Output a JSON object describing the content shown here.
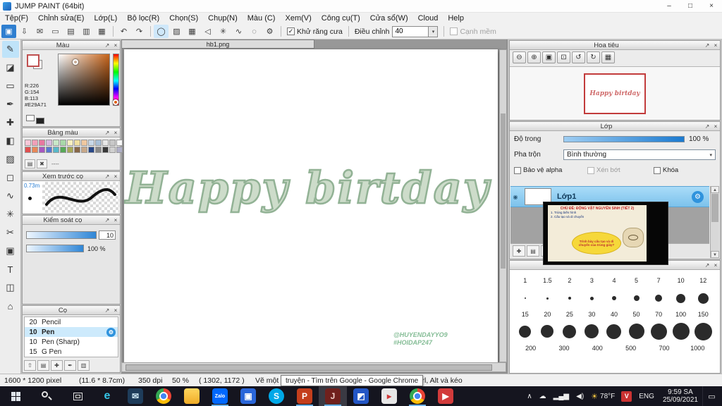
{
  "panel_chrome": {
    "undock_glyph": "↗",
    "close_glyph": "×",
    "check_glyph": "✓"
  },
  "window": {
    "title": "JUMP PAINT (64bit)",
    "buttons": {
      "min": "–",
      "max": "□",
      "close": "×"
    }
  },
  "menu": {
    "items": [
      "Tệp(F)",
      "Chỉnh sửa(E)",
      "Lớp(L)",
      "Bộ lọc(R)",
      "Chọn(S)",
      "Chụp(N)",
      "Màu (C)",
      "Xem(V)",
      "Công cụ(T)",
      "Cửa sổ(W)",
      "Cloud",
      "Help"
    ]
  },
  "toolbar": {
    "file_icons": [
      {
        "name": "paint-logo-icon",
        "glyph": "▣",
        "bg": "#2f7fd0",
        "fg": "#ffffff"
      },
      {
        "name": "export-icon",
        "glyph": "⇩"
      },
      {
        "name": "comment-icon",
        "glyph": "✉"
      },
      {
        "name": "display-icon",
        "glyph": "▭"
      },
      {
        "name": "new-canvas-icon",
        "glyph": "▤"
      },
      {
        "name": "open-canvas-icon",
        "glyph": "▥"
      },
      {
        "name": "grid-icon",
        "glyph": "▦"
      }
    ],
    "history_icons": [
      {
        "name": "undo-icon",
        "glyph": "↶"
      },
      {
        "name": "redo-icon",
        "glyph": "↷"
      }
    ],
    "mode_icons": [
      {
        "name": "ellipse-select-icon",
        "glyph": "◯",
        "bg": "#cfe8fa"
      },
      {
        "name": "tone-icon",
        "glyph": "▨"
      },
      {
        "name": "mesh-icon",
        "glyph": "▦"
      },
      {
        "name": "flip-icon",
        "glyph": "◁"
      },
      {
        "name": "symmetry-icon",
        "glyph": "✳"
      },
      {
        "name": "curve-icon",
        "glyph": "∿"
      },
      {
        "name": "circle-guide-icon",
        "glyph": "◌"
      },
      {
        "name": "tool-settings-icon",
        "glyph": "⚙"
      }
    ],
    "antialias_label": "Khử răng cưa",
    "adjust_label": "Điều chỉnh",
    "adjust_value": "40",
    "soft_edge_label": "Cạnh mềm"
  },
  "tools": [
    {
      "name": "pen-tool",
      "glyph": "✎",
      "bg": "#bfe3f9"
    },
    {
      "name": "eraser-tool",
      "glyph": "◪"
    },
    {
      "name": "shape-brush-tool",
      "glyph": "▭"
    },
    {
      "name": "dot-pen-tool",
      "glyph": "✒"
    },
    {
      "name": "move-tool",
      "glyph": "✚"
    },
    {
      "name": "fill-tool",
      "glyph": "◧"
    },
    {
      "name": "gradient-tool",
      "glyph": "▨"
    },
    {
      "name": "select-tool",
      "glyph": "◻"
    },
    {
      "name": "lasso-tool",
      "glyph": "∿"
    },
    {
      "name": "wand-tool",
      "glyph": "✳"
    },
    {
      "name": "divide-tool",
      "glyph": "✂"
    },
    {
      "name": "operation-tool",
      "glyph": "▣"
    },
    {
      "name": "text-tool",
      "glyph": "T"
    },
    {
      "name": "frame-tool",
      "glyph": "◫"
    },
    {
      "name": "snap-tool",
      "glyph": "⌂"
    }
  ],
  "color_panel": {
    "title": "Màu",
    "r": "R:226",
    "g": "G:154",
    "b": "B:113",
    "hex": "#E29A71"
  },
  "palette_panel": {
    "title": "Bảng màu",
    "line_label": "----",
    "icons": [
      {
        "name": "add-color-icon",
        "glyph": "▤"
      },
      {
        "name": "delete-color-icon",
        "glyph": "✖"
      }
    ],
    "swatches": [
      "#f8c8d8",
      "#f0a0b8",
      "#e878a0",
      "#d8b8e0",
      "#c8e8c8",
      "#a8d8a8",
      "#f8f0c0",
      "#f0e0a0",
      "#f0c8a0",
      "#c8d8e8",
      "#a8c0d8",
      "#e8e8e8",
      "#c8c8c8",
      "#f8f8f8",
      "#e05050",
      "#e88858",
      "#a858c0",
      "#5878d0",
      "#58b8c8",
      "#58a858",
      "#a8a858",
      "#886848",
      "#c8a888",
      "#284888",
      "#888888",
      "#383838",
      "#d0d0d0",
      "#b0b0c8"
    ]
  },
  "brush_preview_panel": {
    "title": "Xem trước cọ",
    "size_label": "0.73m"
  },
  "brush_control_panel": {
    "title": "Kiểm soát cọ",
    "value1": "10",
    "value2": "100 %"
  },
  "brush_panel": {
    "title": "Cọ",
    "items": [
      {
        "size": "20",
        "name": "Pencil"
      },
      {
        "size": "10",
        "name": "Pen"
      },
      {
        "size": "10",
        "name": "Pen (Sharp)"
      },
      {
        "size": "15",
        "name": "G Pen"
      }
    ],
    "icons": [
      {
        "name": "brush-up-icon",
        "glyph": "⇧"
      },
      {
        "name": "add-brush-icon",
        "glyph": "▤"
      },
      {
        "name": "duplicate-brush-icon",
        "glyph": "✚"
      },
      {
        "name": "edit-brush-icon",
        "glyph": "✒"
      },
      {
        "name": "brush-folder-icon",
        "glyph": "▥"
      }
    ]
  },
  "canvas": {
    "tab": "hb1.png",
    "artwork_text": "Happy birtday",
    "watermark_line1": "@HUYENDAYYO9",
    "watermark_line2": "#HOIDAP247"
  },
  "navigator_panel": {
    "title": "Hoa tiêu",
    "buttons": [
      {
        "name": "zoom-out-icon",
        "glyph": "⊖"
      },
      {
        "name": "zoom-in-icon",
        "glyph": "⊕"
      },
      {
        "name": "fit-icon",
        "glyph": "▣"
      },
      {
        "name": "actual-size-icon",
        "glyph": "⊡"
      },
      {
        "name": "rotate-left-icon",
        "glyph": "↺"
      },
      {
        "name": "rotate-right-icon",
        "glyph": "↻"
      },
      {
        "name": "spread-view-icon",
        "glyph": "▦"
      }
    ],
    "thumb_text": "Happy birtday"
  },
  "layer_panel": {
    "title": "Lớp",
    "opacity_label": "Độ trong",
    "opacity_value": "100 %",
    "blend_label": "Pha trộn",
    "blend_value": "Bình thường",
    "alpha_label": "Bảo vệ alpha",
    "clip_label": "Xén bớt",
    "lock_label": "Khóa",
    "layer_name": "Lớp1",
    "icons": [
      {
        "name": "new-layer-icon",
        "glyph": "✚"
      },
      {
        "name": "duplicate-layer-icon",
        "glyph": "▤"
      },
      {
        "name": "merge-layer-icon",
        "glyph": "⇩"
      },
      {
        "name": "layer-up-icon",
        "glyph": "⇧"
      },
      {
        "name": "delete-layer-icon",
        "glyph": "✖"
      }
    ]
  },
  "video_overlay": {
    "title": "CHỦ ĐỀ: ĐỘNG VẬT NGUYÊN SINH (TIẾT 2)",
    "line1": "1. Trùng biến hình",
    "line2": "2. Cấu tạo và di chuyển",
    "bubble": "Trình bày cấu tạo và di chuyển của trùng giày?"
  },
  "size_panel": {
    "labels1": [
      "1",
      "1.5",
      "2",
      "3",
      "4",
      "5",
      "7",
      "10",
      "12"
    ],
    "dots1": [
      2,
      3,
      4,
      5,
      6,
      8,
      10,
      13,
      15
    ],
    "labels2": [
      "15",
      "20",
      "25",
      "30",
      "40",
      "50",
      "70",
      "100",
      "150"
    ],
    "dots2": [
      17,
      18,
      19,
      20,
      21,
      22,
      23,
      24,
      25
    ],
    "labels3": [
      "200",
      "300",
      "400",
      "500",
      "700",
      "1000"
    ]
  },
  "status_bar": {
    "size": "1600 * 1200 pixel",
    "dims": "(11.6 * 8.7cm)",
    "dpi": "350 dpi",
    "zoom": "50 %",
    "coords": "( 1302, 1172 )",
    "hint": "Vẽ một đường thẳng bằng cách giữ p",
    "tooltip": "truyện - Tìm trên Google - Google Chrome",
    "shortcut": "Ctrl, Alt và kéo"
  },
  "taskbar": {
    "apps": [
      {
        "name": "taskbar-edge",
        "glyph": "e",
        "bg": "transparent",
        "fg": "#35c6e8",
        "fs": 16,
        "underline": "transparent",
        "tile": "transparent"
      },
      {
        "name": "taskbar-mail",
        "glyph": "✉",
        "bg": "#1e3c5a",
        "fg": "#cfe8f5",
        "underline": "transparent",
        "tile": "transparent"
      },
      {
        "name": "taskbar-chrome",
        "glyph": "",
        "bg": "radial-gradient(circle at 50% 50%, #4285f4 0 4px, #ffffff 4px 6px, rgba(0,0,0,0) 6px), conic-gradient(#ea4335 0deg 120deg, #fbbc05 120deg 240deg, #34a853 240deg 360deg)",
        "fg": "#fff",
        "radius": "50%",
        "underline": "transparent",
        "tile": "transparent"
      },
      {
        "name": "taskbar-file-explorer",
        "glyph": "",
        "bg": "linear-gradient(#ffd75e,#f0ac28)",
        "fg": "#fff",
        "underline": "transparent",
        "tile": "transparent"
      },
      {
        "name": "taskbar-zalo",
        "glyph": "Zalo",
        "bg": "#0168ff",
        "fg": "#ffffff",
        "fs": 7,
        "underline": "#6fb3e8",
        "tile": "transparent"
      },
      {
        "name": "taskbar-app-blue",
        "glyph": "▣",
        "bg": "#2a66d9",
        "fg": "#ffffff",
        "underline": "transparent",
        "tile": "transparent"
      },
      {
        "name": "taskbar-skype",
        "glyph": "S",
        "bg": "#00a8e8",
        "fg": "#ffffff",
        "radius": "50%",
        "underline": "transparent",
        "tile": "transparent"
      },
      {
        "name": "taskbar-powerpoint",
        "glyph": "P",
        "bg": "#c43e1c",
        "fg": "#ffffff",
        "underline": "#6fb3e8",
        "tile": "transparent"
      },
      {
        "name": "taskbar-jump-paint",
        "glyph": "J",
        "bg": "#70201c",
        "fg": "#f0d0c8",
        "underline": "#6fb3e8",
        "tile": "rgba(255,255,255,0.16)"
      },
      {
        "name": "taskbar-photos",
        "glyph": "◩",
        "bg": "#2356c5",
        "fg": "#ffffff",
        "underline": "transparent",
        "tile": "transparent"
      },
      {
        "name": "taskbar-media",
        "glyph": "▸",
        "bg": "#e8e8e8",
        "fg": "#d03838",
        "underline": "transparent",
        "tile": "transparent"
      },
      {
        "name": "taskbar-chrome-2",
        "glyph": "",
        "bg": "radial-gradient(circle at 50% 50%, #4285f4 0 4px, #ffffff 4px 6px, rgba(0,0,0,0) 6px), conic-gradient(#ea4335 0deg 120deg, #fbbc05 120deg 240deg, #34a853 240deg 360deg)",
        "fg": "#fff",
        "radius": "50%",
        "underline": "#6fb3e8",
        "tile": "transparent"
      },
      {
        "name": "taskbar-app-red",
        "glyph": "▶",
        "bg": "#d23b3b",
        "fg": "#ffffff",
        "underline": "transparent",
        "tile": "transparent"
      }
    ],
    "tray_icons": [
      {
        "name": "tray-expand-icon",
        "glyph": "∧"
      },
      {
        "name": "onedrive-icon",
        "glyph": "☁"
      },
      {
        "name": "network-icon",
        "glyph": "▂▄▆"
      },
      {
        "name": "volume-icon",
        "glyph": "◀)"
      }
    ],
    "sun_glyph": "☀",
    "temp": "78°F",
    "vlc_label": "V",
    "lang": "ENG",
    "time": "9:59 SA",
    "date": "25/09/2021",
    "notif_glyph": "▭"
  }
}
